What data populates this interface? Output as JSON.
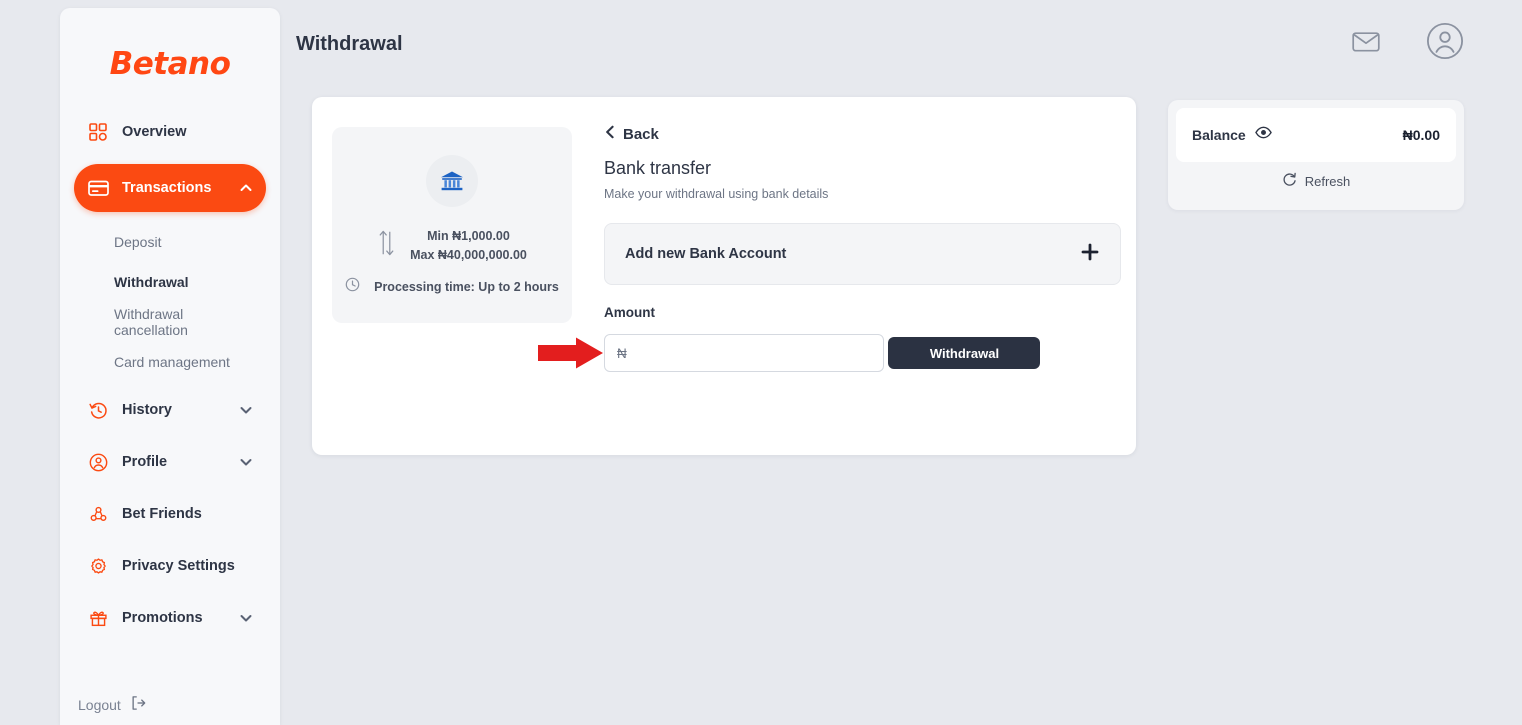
{
  "brand": {
    "logo_text": "Betano",
    "accent": "#fb4a12",
    "dark": "#2b3242"
  },
  "header": {
    "title": "Withdrawal",
    "messages_icon": "envelope-icon",
    "account_icon": "user-circle-icon"
  },
  "sidebar": {
    "items": [
      {
        "label": "Overview",
        "icon": "grid-icon",
        "active": false,
        "chevron": ""
      },
      {
        "label": "Transactions",
        "icon": "card-icon",
        "active": true,
        "chevron": "up"
      },
      {
        "label": "History",
        "icon": "history-clock-icon",
        "active": false,
        "chevron": "down"
      },
      {
        "label": "Profile",
        "icon": "user-circle-icon",
        "active": false,
        "chevron": "down"
      },
      {
        "label": "Bet Friends",
        "icon": "friends-icon",
        "active": false,
        "chevron": ""
      },
      {
        "label": "Privacy Settings",
        "icon": "gear-icon",
        "active": false,
        "chevron": ""
      },
      {
        "label": "Promotions",
        "icon": "gift-icon",
        "active": false,
        "chevron": "down"
      }
    ],
    "transactions_submenu": [
      {
        "label": "Deposit",
        "current": false
      },
      {
        "label": "Withdrawal",
        "current": true
      },
      {
        "label": "Withdrawal cancellation",
        "current": false
      },
      {
        "label": "Card management",
        "current": false
      }
    ],
    "logout_label": "Logout",
    "logout_icon": "logout-icon"
  },
  "main": {
    "info": {
      "bank_icon": "bank-building-icon",
      "limits_icon": "up-down-arrows-icon",
      "min_text": "Min ₦1,000.00",
      "max_text": "Max ₦40,000,000.00",
      "clock_icon": "clock-icon",
      "processing_text": "Processing time: Up to 2 hours"
    },
    "back_label": "Back",
    "back_icon": "chevron-left-icon",
    "method_title": "Bank transfer",
    "method_subtitle": "Make your withdrawal using bank details",
    "add_account_label": "Add new Bank Account",
    "add_account_icon": "plus-icon",
    "amount_label": "Amount",
    "amount_value": "",
    "amount_placeholder": "₦",
    "submit_label": "Withdrawal",
    "annotation_icon": "red-arrow-right-icon",
    "annotation_color": "#e31e1e"
  },
  "balance": {
    "label": "Balance",
    "visibility_icon": "eye-icon",
    "amount": "₦0.00",
    "refresh_label": "Refresh",
    "refresh_icon": "refresh-icon"
  }
}
